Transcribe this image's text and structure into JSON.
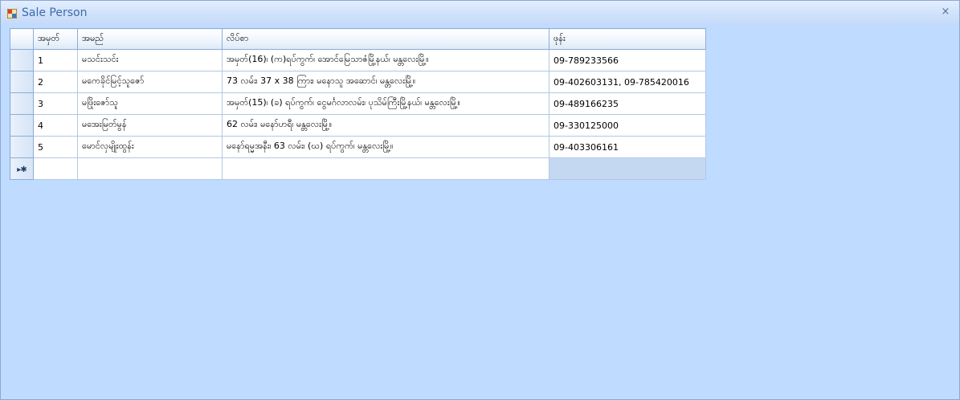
{
  "window": {
    "title": "Sale Person",
    "close_label": "×",
    "colors": {
      "background": "#bfdbff",
      "title_text": "#3e6aaa",
      "header_border": "#8eacd3"
    }
  },
  "grid": {
    "columns": [
      "အမှတ်",
      "အမည်",
      "လိပ်စာ",
      "ဖုန်း"
    ],
    "rows": [
      [
        "1",
        "မသင်းသင်း",
        "အမှတ်(16)၊ (က)ရပ်ကွက်၊ အောင်မြေသာဇံမြို့နယ်၊ မန္တလေးမြို့။",
        "09-789233566"
      ],
      [
        "2",
        "မကေခိုင်မြင့်သူဇော်",
        "73 လမ်း၊ 37 x 38 ကြား၊ မနောသူ အဆောင်၊ မန္တလေးမြို့။",
        "09-402603131, 09-785420016"
      ],
      [
        "3",
        "မဖြိုးဇော်သူ",
        "အမှတ်(15)၊ (ခ) ရပ်ကွက်၊ ငွေမင်္ဂလာလမ်း၊ ပုသိမ်ကြီးမြို့နယ်၊ မန္တလေးမြို့။",
        "09-489166235"
      ],
      [
        "4",
        "မအေးမြတ်မွန်",
        "62 လမ်း၊ မနော်ဟရီ၊ မန္တလေးမြို့။",
        "09-330125000"
      ],
      [
        "5",
        "မောင်လှမျိုးထွန်း",
        "မနော်ရမ္မအနီး၊ 63 လမ်း၊ (ဃ) ရပ်ကွက်၊ မန္တလေးမြို့။",
        "09-403306161"
      ]
    ],
    "new_row_indicator": "▸✱"
  }
}
